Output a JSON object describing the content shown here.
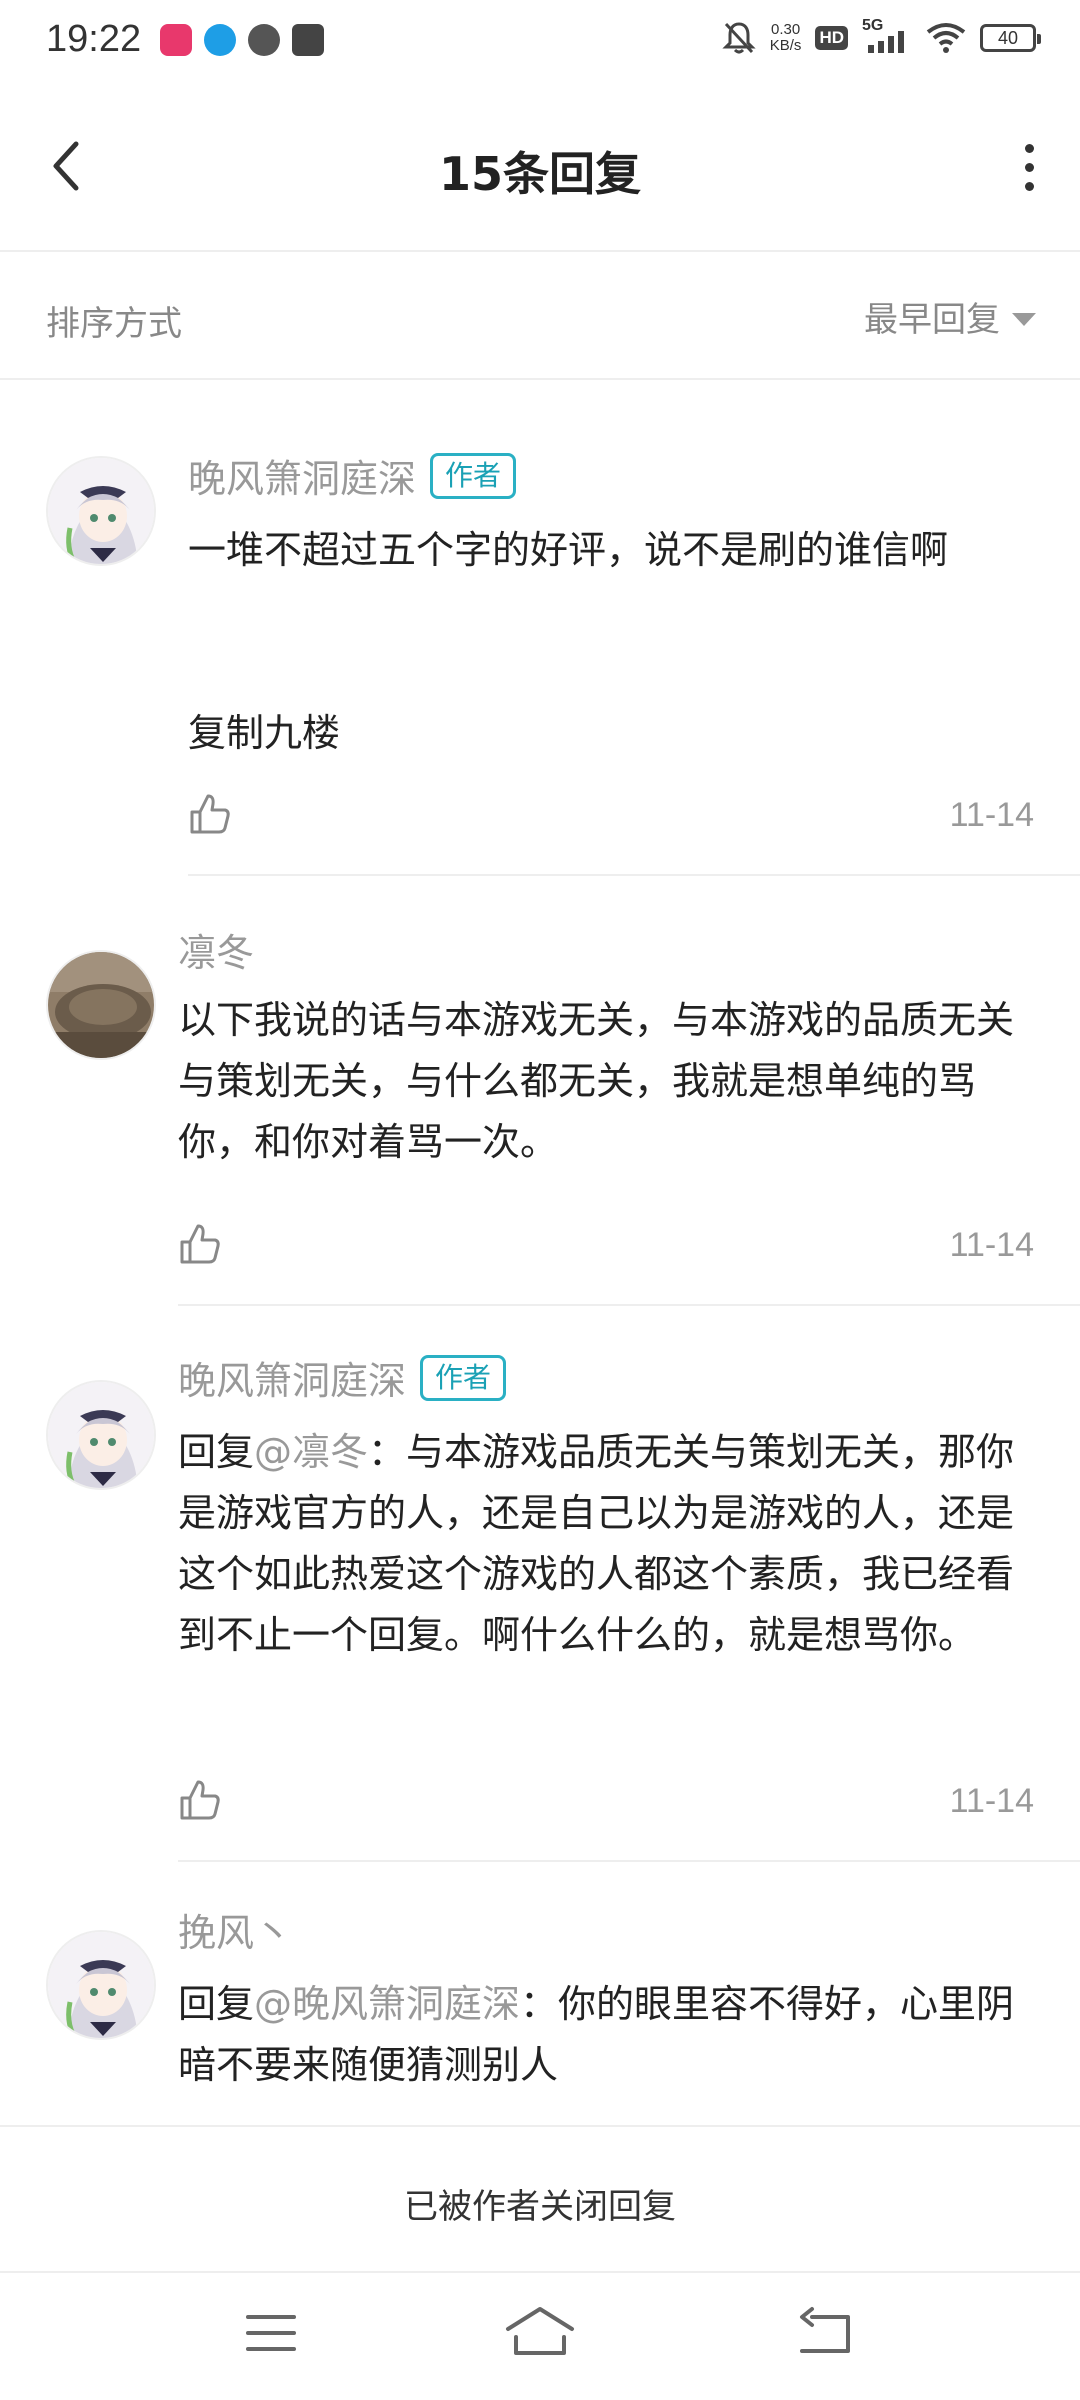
{
  "status_bar": {
    "time": "19:22",
    "net_speed_value": "0.30",
    "net_speed_unit": "KB/s",
    "hd": "HD",
    "network": "5G",
    "battery": "40",
    "icons": [
      "notification-app-icon",
      "compass-app-icon",
      "clock-app-icon",
      "message-app-icon",
      "mute-bell-icon",
      "signal-icon",
      "wifi-icon",
      "battery-icon"
    ]
  },
  "header": {
    "title": "15条回复",
    "back_icon": "chevron-left-icon",
    "more_icon": "more-vertical-icon"
  },
  "sort": {
    "label": "排序方式",
    "selected": "最早回复"
  },
  "comments": [
    {
      "username": "晚风箫洞庭深",
      "badge": "作者",
      "line1": "一堆不超过五个字的好评，说不是刷的谁信啊",
      "line2": "复制九楼",
      "date": "11-14"
    },
    {
      "username": "凛冬",
      "badge": "",
      "text": "以下我说的话与本游戏无关，与本游戏的品质无关与策划无关，与什么都无关，我就是想单纯的骂你，和你对着骂一次。",
      "date": "11-14"
    },
    {
      "username": "晚风箫洞庭深",
      "badge": "作者",
      "reply_prefix": "回复",
      "mention": "@凛冬",
      "text": "：与本游戏品质无关与策划无关，那你是游戏官方的人，还是自己以为是游戏的人，还是这个如此热爱这个游戏的人都这个素质，我已经看到不止一个回复。啊什么什么的，就是想骂你。",
      "date": "11-14"
    },
    {
      "username": "挽风丶",
      "badge": "",
      "reply_prefix": "回复",
      "mention": "@晚风箫洞庭深",
      "text": "：你的眼里容不得好，心里阴暗不要来随便猜测别人",
      "date": ""
    }
  ],
  "footer": {
    "closed_text": "已被作者关闭回复"
  },
  "nav": {
    "icons": [
      "menu-icon",
      "home-icon",
      "back-icon"
    ]
  },
  "colors": {
    "badge": "#2ab0c4",
    "username": "#999999",
    "text": "#222222"
  }
}
